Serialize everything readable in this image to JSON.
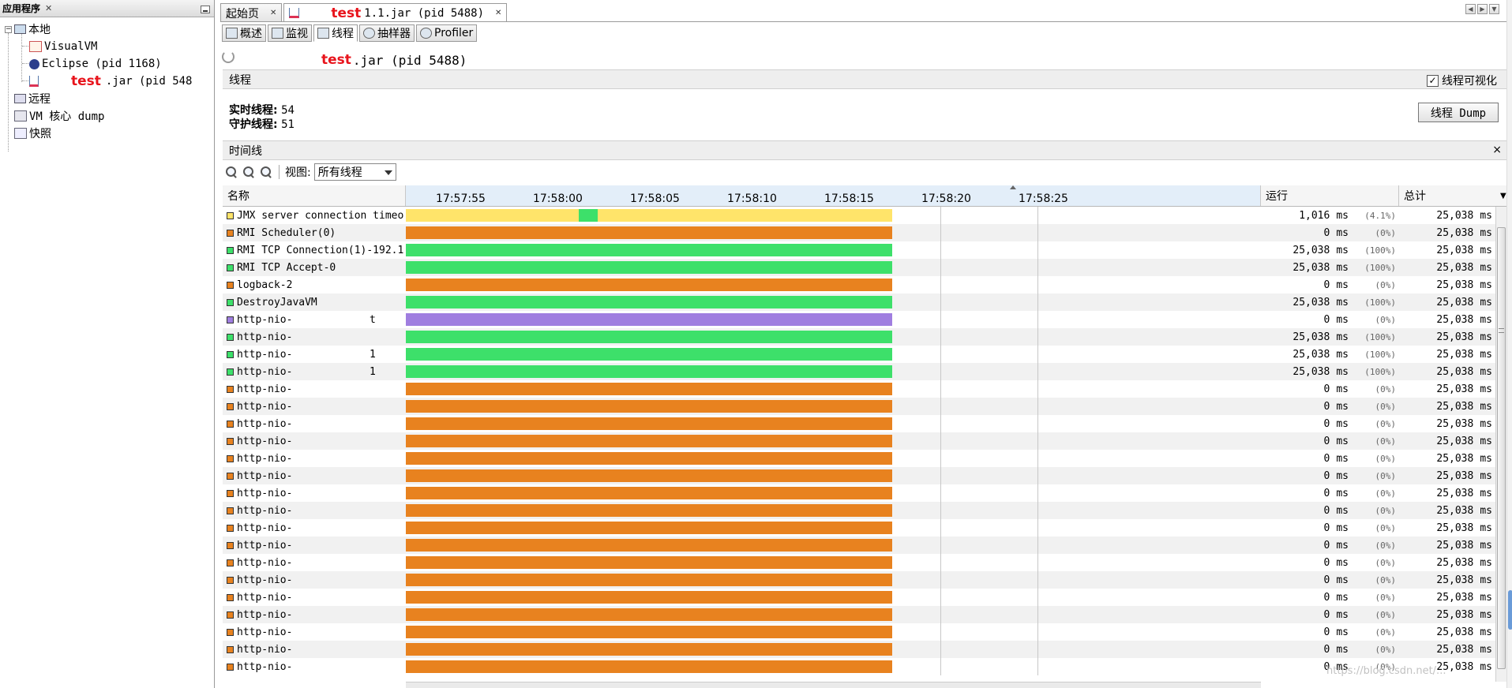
{
  "left_panel": {
    "title": "应用程序",
    "tree": {
      "local": "本地",
      "visualvm": "VisualVM",
      "eclipse": "Eclipse (pid 1168)",
      "app_red": "test",
      "app_rest": ".jar (pid 548",
      "remote": "远程",
      "coredump": "VM 核心 dump",
      "snapshots": "快照"
    }
  },
  "doc_tabs": {
    "start_page": "起始页",
    "app_red": "test",
    "app_rest": "1.1.jar (pid 5488)"
  },
  "view_tabs": [
    "概述",
    "监视",
    "线程",
    "抽样器",
    "Profiler"
  ],
  "header": {
    "app_red": "test",
    "app_rest": ".jar (pid 5488)"
  },
  "threads_section": {
    "title": "线程",
    "visualize_label": "线程可视化",
    "live_label": "实时线程:",
    "live_value": "54",
    "daemon_label": "守护线程:",
    "daemon_value": "51",
    "dump_button": "线程 Dump"
  },
  "timeline": {
    "title": "时间线",
    "close": "×",
    "view_label": "视图:",
    "view_value": "所有线程",
    "columns": {
      "name": "名称",
      "run": "运行",
      "total": "总计"
    },
    "ticks": [
      "17:57:55",
      "17:58:00",
      "17:58:05",
      "17:58:10",
      "17:58:15",
      "17:58:20",
      "17:58:25"
    ]
  },
  "colors": {
    "running": "#3de06a",
    "sleeping": "#e8821f",
    "wait": "#ffe46a",
    "park": "#a07ee0"
  },
  "threads": [
    {
      "name": "JMX server connection timeo",
      "state": "wait",
      "run": "1,016",
      "pct": "(4.1%)",
      "total": "25,038",
      "segments": [
        {
          "from": 0,
          "to": 0.355,
          "state": "wait"
        },
        {
          "from": 0.355,
          "to": 0.395,
          "state": "running"
        },
        {
          "from": 0.395,
          "to": 1,
          "state": "wait"
        }
      ]
    },
    {
      "name": "RMI Scheduler(0)",
      "state": "sleeping",
      "run": "0",
      "pct": "(0%)",
      "total": "25,038"
    },
    {
      "name": "RMI TCP Connection(1)-192.1",
      "state": "running",
      "run": "25,038",
      "pct": "(100%)",
      "total": "25,038"
    },
    {
      "name": "RMI TCP Accept-0",
      "state": "running",
      "run": "25,038",
      "pct": "(100%)",
      "total": "25,038"
    },
    {
      "name": "logback-2",
      "state": "sleeping",
      "run": "0",
      "pct": "(0%)",
      "total": "25,038"
    },
    {
      "name": "DestroyJavaVM",
      "state": "running",
      "run": "25,038",
      "pct": "(100%)",
      "total": "25,038"
    },
    {
      "name": "http-nio-",
      "suffix": "t",
      "state": "park",
      "run": "0",
      "pct": "(0%)",
      "total": "25,038"
    },
    {
      "name": "http-nio-",
      "state": "running",
      "run": "25,038",
      "pct": "(100%)",
      "total": "25,038"
    },
    {
      "name": "http-nio-",
      "suffix": "1",
      "state": "running",
      "run": "25,038",
      "pct": "(100%)",
      "total": "25,038"
    },
    {
      "name": "http-nio-",
      "suffix": "1",
      "state": "running",
      "run": "25,038",
      "pct": "(100%)",
      "total": "25,038"
    },
    {
      "name": "http-nio-",
      "state": "sleeping",
      "run": "0",
      "pct": "(0%)",
      "total": "25,038"
    },
    {
      "name": "http-nio-",
      "state": "sleeping",
      "run": "0",
      "pct": "(0%)",
      "total": "25,038"
    },
    {
      "name": "http-nio-",
      "state": "sleeping",
      "run": "0",
      "pct": "(0%)",
      "total": "25,038"
    },
    {
      "name": "http-nio-",
      "state": "sleeping",
      "run": "0",
      "pct": "(0%)",
      "total": "25,038"
    },
    {
      "name": "http-nio-",
      "state": "sleeping",
      "run": "0",
      "pct": "(0%)",
      "total": "25,038"
    },
    {
      "name": "http-nio-",
      "state": "sleeping",
      "run": "0",
      "pct": "(0%)",
      "total": "25,038"
    },
    {
      "name": "http-nio-",
      "state": "sleeping",
      "run": "0",
      "pct": "(0%)",
      "total": "25,038"
    },
    {
      "name": "http-nio-",
      "state": "sleeping",
      "run": "0",
      "pct": "(0%)",
      "total": "25,038"
    },
    {
      "name": "http-nio-",
      "state": "sleeping",
      "run": "0",
      "pct": "(0%)",
      "total": "25,038"
    },
    {
      "name": "http-nio-",
      "state": "sleeping",
      "run": "0",
      "pct": "(0%)",
      "total": "25,038"
    },
    {
      "name": "http-nio-",
      "state": "sleeping",
      "run": "0",
      "pct": "(0%)",
      "total": "25,038"
    },
    {
      "name": "http-nio-",
      "state": "sleeping",
      "run": "0",
      "pct": "(0%)",
      "total": "25,038"
    },
    {
      "name": "http-nio-",
      "state": "sleeping",
      "run": "0",
      "pct": "(0%)",
      "total": "25,038"
    },
    {
      "name": "http-nio-",
      "state": "sleeping",
      "run": "0",
      "pct": "(0%)",
      "total": "25,038"
    },
    {
      "name": "http-nio-",
      "state": "sleeping",
      "run": "0",
      "pct": "(0%)",
      "total": "25,038"
    },
    {
      "name": "http-nio-",
      "state": "sleeping",
      "run": "0",
      "pct": "(0%)",
      "total": "25,038"
    },
    {
      "name": "http-nio-",
      "state": "sleeping",
      "run": "0",
      "pct": "(0%)",
      "total": "25,038"
    }
  ],
  "unit_ms": "ms",
  "watermark": "https://blog.csdn.net/..."
}
